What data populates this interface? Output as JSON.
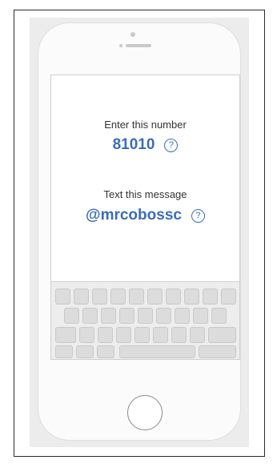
{
  "screen": {
    "number_label": "Enter this number",
    "number_value": "81010",
    "message_label": "Text this message",
    "message_value": "@mrcobossc",
    "help_glyph": "?"
  },
  "icons": {
    "help": "question-circle-icon",
    "home": "home-button-circle"
  },
  "colors": {
    "accent": "#3a6db8",
    "label_text": "#333333",
    "phone_body": "#fbfbfb",
    "panel_background": "#ececec",
    "keyboard_key": "#dcdcdc"
  }
}
